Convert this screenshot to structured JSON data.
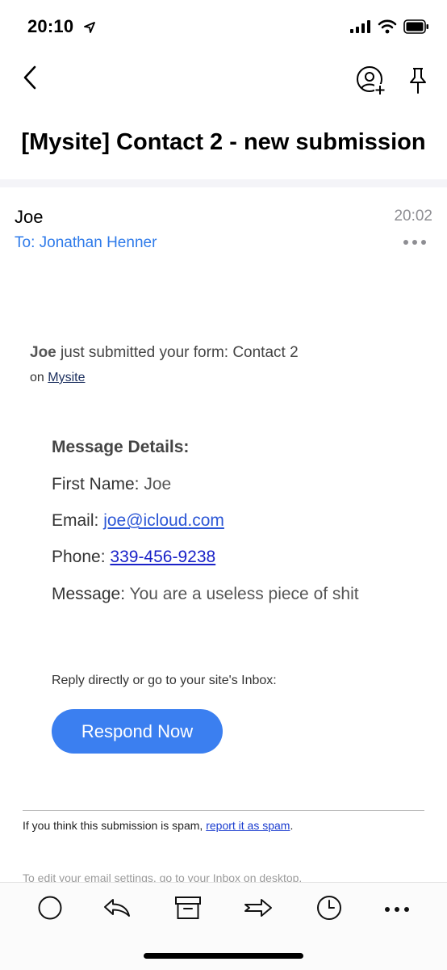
{
  "status_bar": {
    "time": "20:10"
  },
  "header": {
    "subject": "[Mysite] Contact 2 - new submission"
  },
  "message_header": {
    "sender": "Joe",
    "recipient": "To: Jonathan Henner",
    "time": "20:02"
  },
  "body": {
    "intro_name": "Joe",
    "intro_text": " just submitted your form: Contact 2",
    "on_prefix": "on ",
    "site_link": "Mysite",
    "details_title": "Message Details:",
    "fields": {
      "first_name": {
        "label": "First Name:",
        "value": "Joe"
      },
      "email": {
        "label": "Email:",
        "value": "joe@icloud.com"
      },
      "phone": {
        "label": "Phone:",
        "value": "339-456-9238"
      },
      "message": {
        "label": "Message:",
        "value": "You are a useless piece of shit"
      }
    },
    "reply_hint": "Reply directly or go to your site's Inbox:",
    "respond_button": "Respond Now",
    "spam_prefix": "If you think this submission is spam, ",
    "spam_link": "report it as spam",
    "spam_suffix": ".",
    "edit_settings": "To edit your email settings, go to your Inbox on desktop."
  },
  "toolbar": {
    "icons": [
      "circle-icon",
      "reply-icon",
      "archive-icon",
      "forward-icon",
      "clock-icon",
      "more-icon"
    ]
  },
  "colors": {
    "accent": "#2f7bea",
    "button": "#3b7ff0",
    "phone_link": "#1a22c8",
    "email_link": "#2b56d6"
  }
}
